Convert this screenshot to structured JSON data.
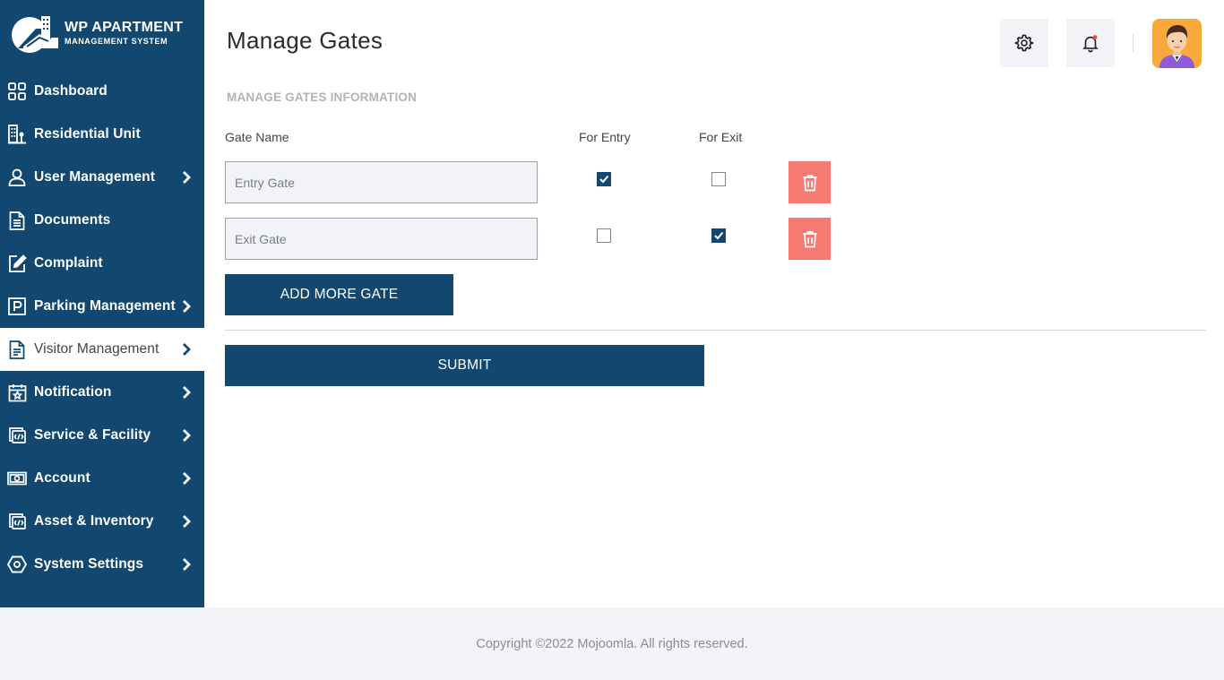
{
  "brand": {
    "title": "WP APARTMENT",
    "subtitle": "MANAGEMENT SYSTEM"
  },
  "sidebar": {
    "items": [
      {
        "label": "Dashboard",
        "icon": "dashboard-grid-icon",
        "has_submenu": false
      },
      {
        "label": "Residential Unit",
        "icon": "building-icon",
        "has_submenu": false
      },
      {
        "label": "User Management",
        "icon": "user-icon",
        "has_submenu": true
      },
      {
        "label": "Documents",
        "icon": "document-icon",
        "has_submenu": false
      },
      {
        "label": "Complaint",
        "icon": "edit-icon",
        "has_submenu": false
      },
      {
        "label": "Parking Management",
        "icon": "parking-icon",
        "has_submenu": true
      },
      {
        "label": "Visitor Management",
        "icon": "file-text-icon",
        "has_submenu": true,
        "active": true
      },
      {
        "label": "Notification",
        "icon": "calendar-star-icon",
        "has_submenu": true
      },
      {
        "label": "Service & Facility",
        "icon": "service-icon",
        "has_submenu": true
      },
      {
        "label": "Account",
        "icon": "money-icon",
        "has_submenu": true
      },
      {
        "label": "Asset & Inventory",
        "icon": "asset-icon",
        "has_submenu": true
      },
      {
        "label": "System Settings",
        "icon": "settings-eye-icon",
        "has_submenu": true
      }
    ]
  },
  "header": {
    "title": "Manage Gates",
    "settings_icon": "gear-icon",
    "notification_icon": "bell-icon",
    "avatar": "user-avatar"
  },
  "form": {
    "section_title": "MANAGE GATES INFORMATION",
    "columns": {
      "gate_name": "Gate Name",
      "for_entry": "For Entry",
      "for_exit": "For Exit"
    },
    "gates": [
      {
        "placeholder": "Entry Gate",
        "value": "",
        "for_entry": true,
        "for_exit": false
      },
      {
        "placeholder": "Exit Gate",
        "value": "",
        "for_entry": false,
        "for_exit": true
      }
    ],
    "add_button": "ADD MORE GATE",
    "submit_button": "SUBMIT"
  },
  "footer": {
    "copyright": "Copyright ©2022 Mojoomla. All rights reserved."
  },
  "colors": {
    "primary": "#12486f",
    "delete": "#f47a72",
    "footer_bg": "#f2f4f8"
  }
}
